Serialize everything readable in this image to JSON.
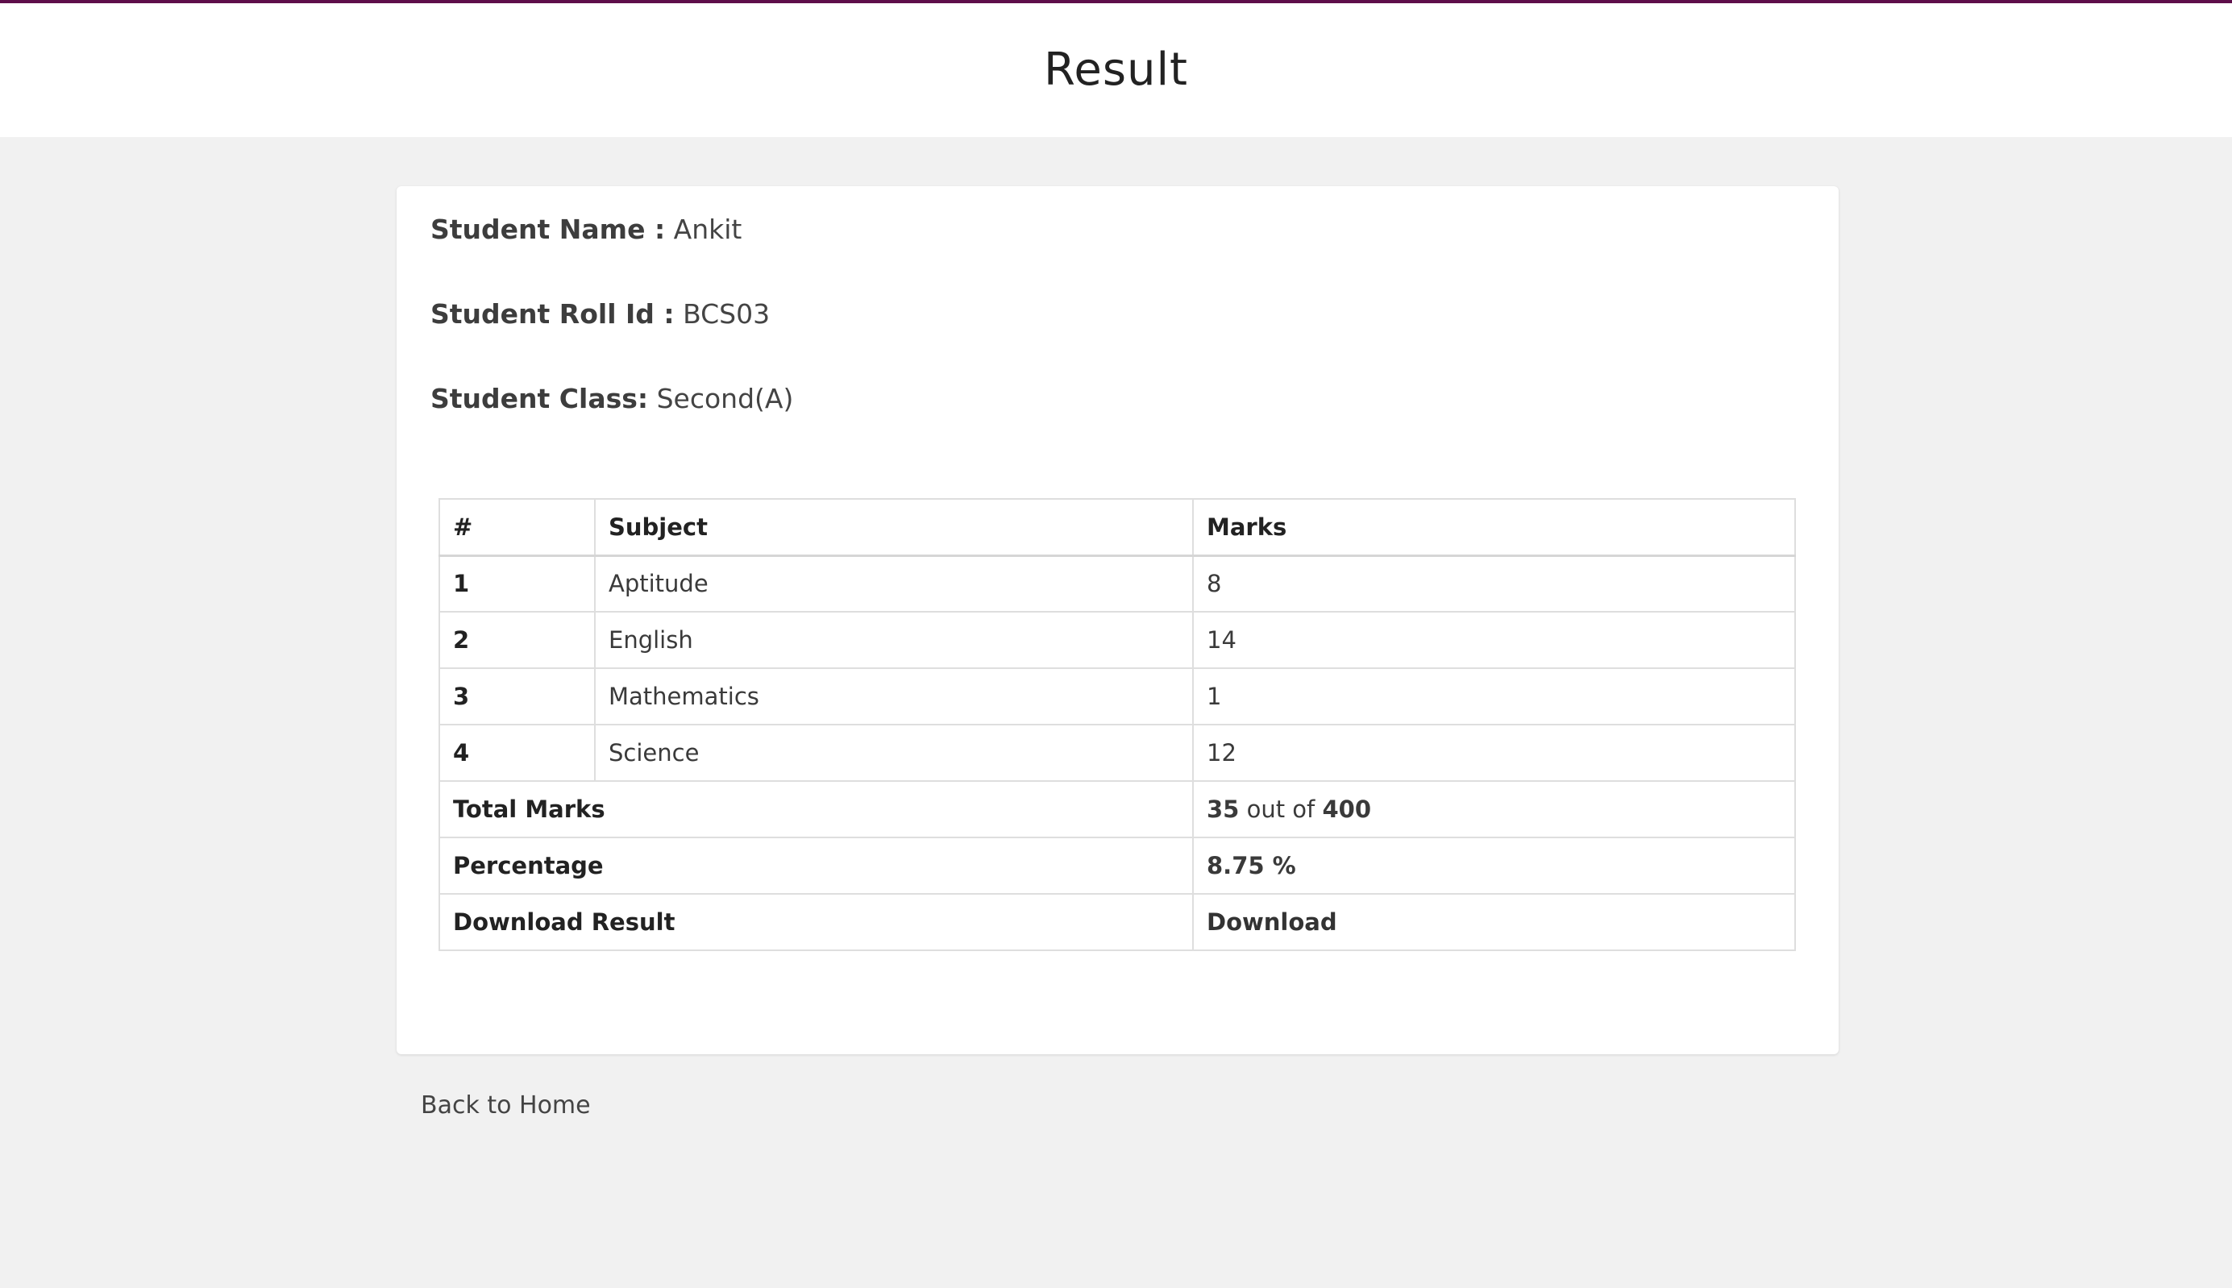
{
  "header": {
    "title": "Result"
  },
  "student": {
    "name_label": "Student Name :",
    "name_value": "Ankit",
    "roll_label": "Student Roll Id :",
    "roll_value": "BCS03",
    "class_label": "Student Class:",
    "class_value": "Second(A)"
  },
  "table": {
    "headers": [
      "#",
      "Subject",
      "Marks"
    ],
    "rows": [
      {
        "num": "1",
        "subject": "Aptitude",
        "marks": "8"
      },
      {
        "num": "2",
        "subject": "English",
        "marks": "14"
      },
      {
        "num": "3",
        "subject": "Mathematics",
        "marks": "1"
      },
      {
        "num": "4",
        "subject": "Science",
        "marks": "12"
      }
    ],
    "total": {
      "label": "Total Marks",
      "obtained": "35",
      "separator": "out of",
      "max": "400"
    },
    "percentage": {
      "label": "Percentage",
      "value": "8.75 %"
    },
    "download": {
      "label": "Download Result",
      "link_text": "Download"
    }
  },
  "footer": {
    "back_link": "Back to Home"
  },
  "colors": {
    "header_top_border": "#5e0e4a",
    "page_background": "#f1f1f1",
    "card_background": "#ffffff"
  }
}
